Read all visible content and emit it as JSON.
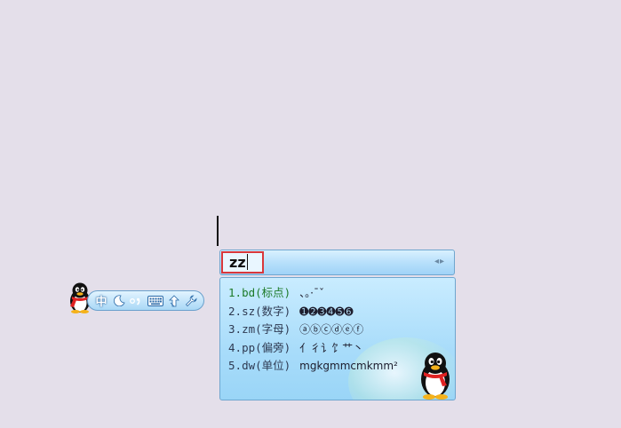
{
  "composition": {
    "input_text": "zz",
    "page_arrows": "◂ ▸"
  },
  "candidates": [
    {
      "num": "1.",
      "code": "bd(标点)",
      "symbols": "、。·¯ˇ",
      "selected": true
    },
    {
      "num": "2.",
      "code": "sz(数字)",
      "symbols": "➊➋➌➍➎➏",
      "selected": false
    },
    {
      "num": "3.",
      "code": "zm(字母)",
      "symbols": "ⓐⓑⓒⓓⓔⓕ",
      "selected": false
    },
    {
      "num": "4.",
      "code": "pp(偏旁)",
      "symbols": "亻彳讠饣艹丶",
      "selected": false
    },
    {
      "num": "5.",
      "code": "dw(单位)",
      "symbols": "mgkgmmcmkmm²",
      "selected": false
    }
  ],
  "status_bar": {
    "mode_label": "中",
    "items": [
      "moon-icon",
      "punctuation-icon",
      "keyboard-icon",
      "switch-icon",
      "wrench-icon"
    ],
    "mode_color": "#ffffff"
  },
  "colors": {
    "background": "#e4dfea",
    "panel_blue": "#a8dcfa",
    "highlight_box": "#d9373b",
    "selected_text": "#1d7a28"
  }
}
